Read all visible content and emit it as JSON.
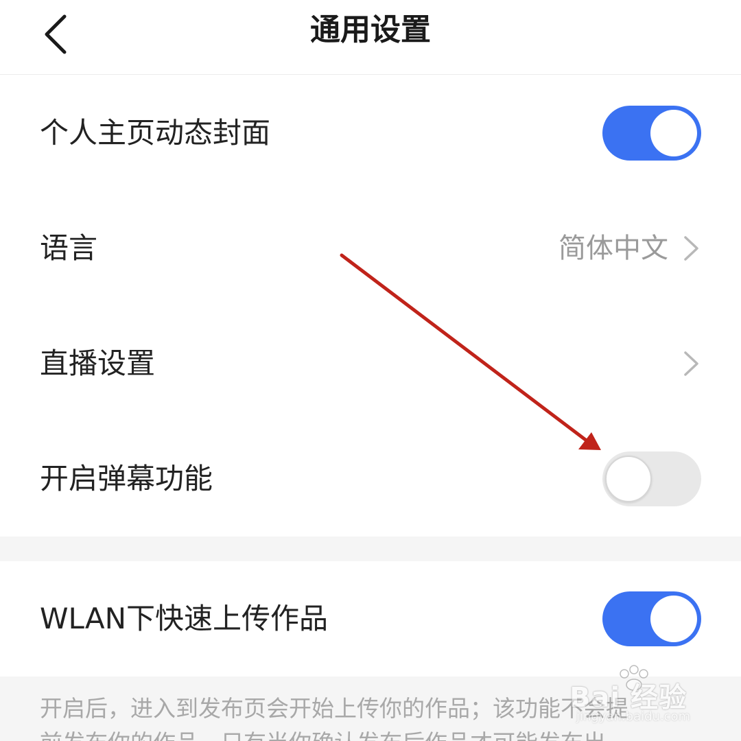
{
  "header": {
    "title": "通用设置",
    "back_icon": "back-chevron-icon"
  },
  "settings": [
    {
      "label": "个人主页动态封面",
      "control": "toggle",
      "toggle_on": true
    },
    {
      "label": "语言",
      "control": "link",
      "value": "简体中文"
    },
    {
      "label": "直播设置",
      "control": "link"
    },
    {
      "label": "开启弹幕功能",
      "control": "toggle",
      "toggle_on": false
    }
  ],
  "wlan": {
    "label": "WLAN下快速上传作品",
    "control": "toggle",
    "toggle_on": true
  },
  "footer": {
    "note_line1": "开启后，进入到发布页会开始上传你的作品；该功能不会提",
    "note_line2": "前发布你的作品，只有当你确认发布后作品才可能发布出"
  },
  "watermark": {
    "brand": "Bai 经验",
    "url": "jingyan.baidu.com"
  },
  "colors": {
    "accent": "#3b72f2",
    "toggle_off": "#e8e8e8",
    "annotation_arrow": "#c0231a",
    "secondary_text": "#9a9a9a"
  }
}
